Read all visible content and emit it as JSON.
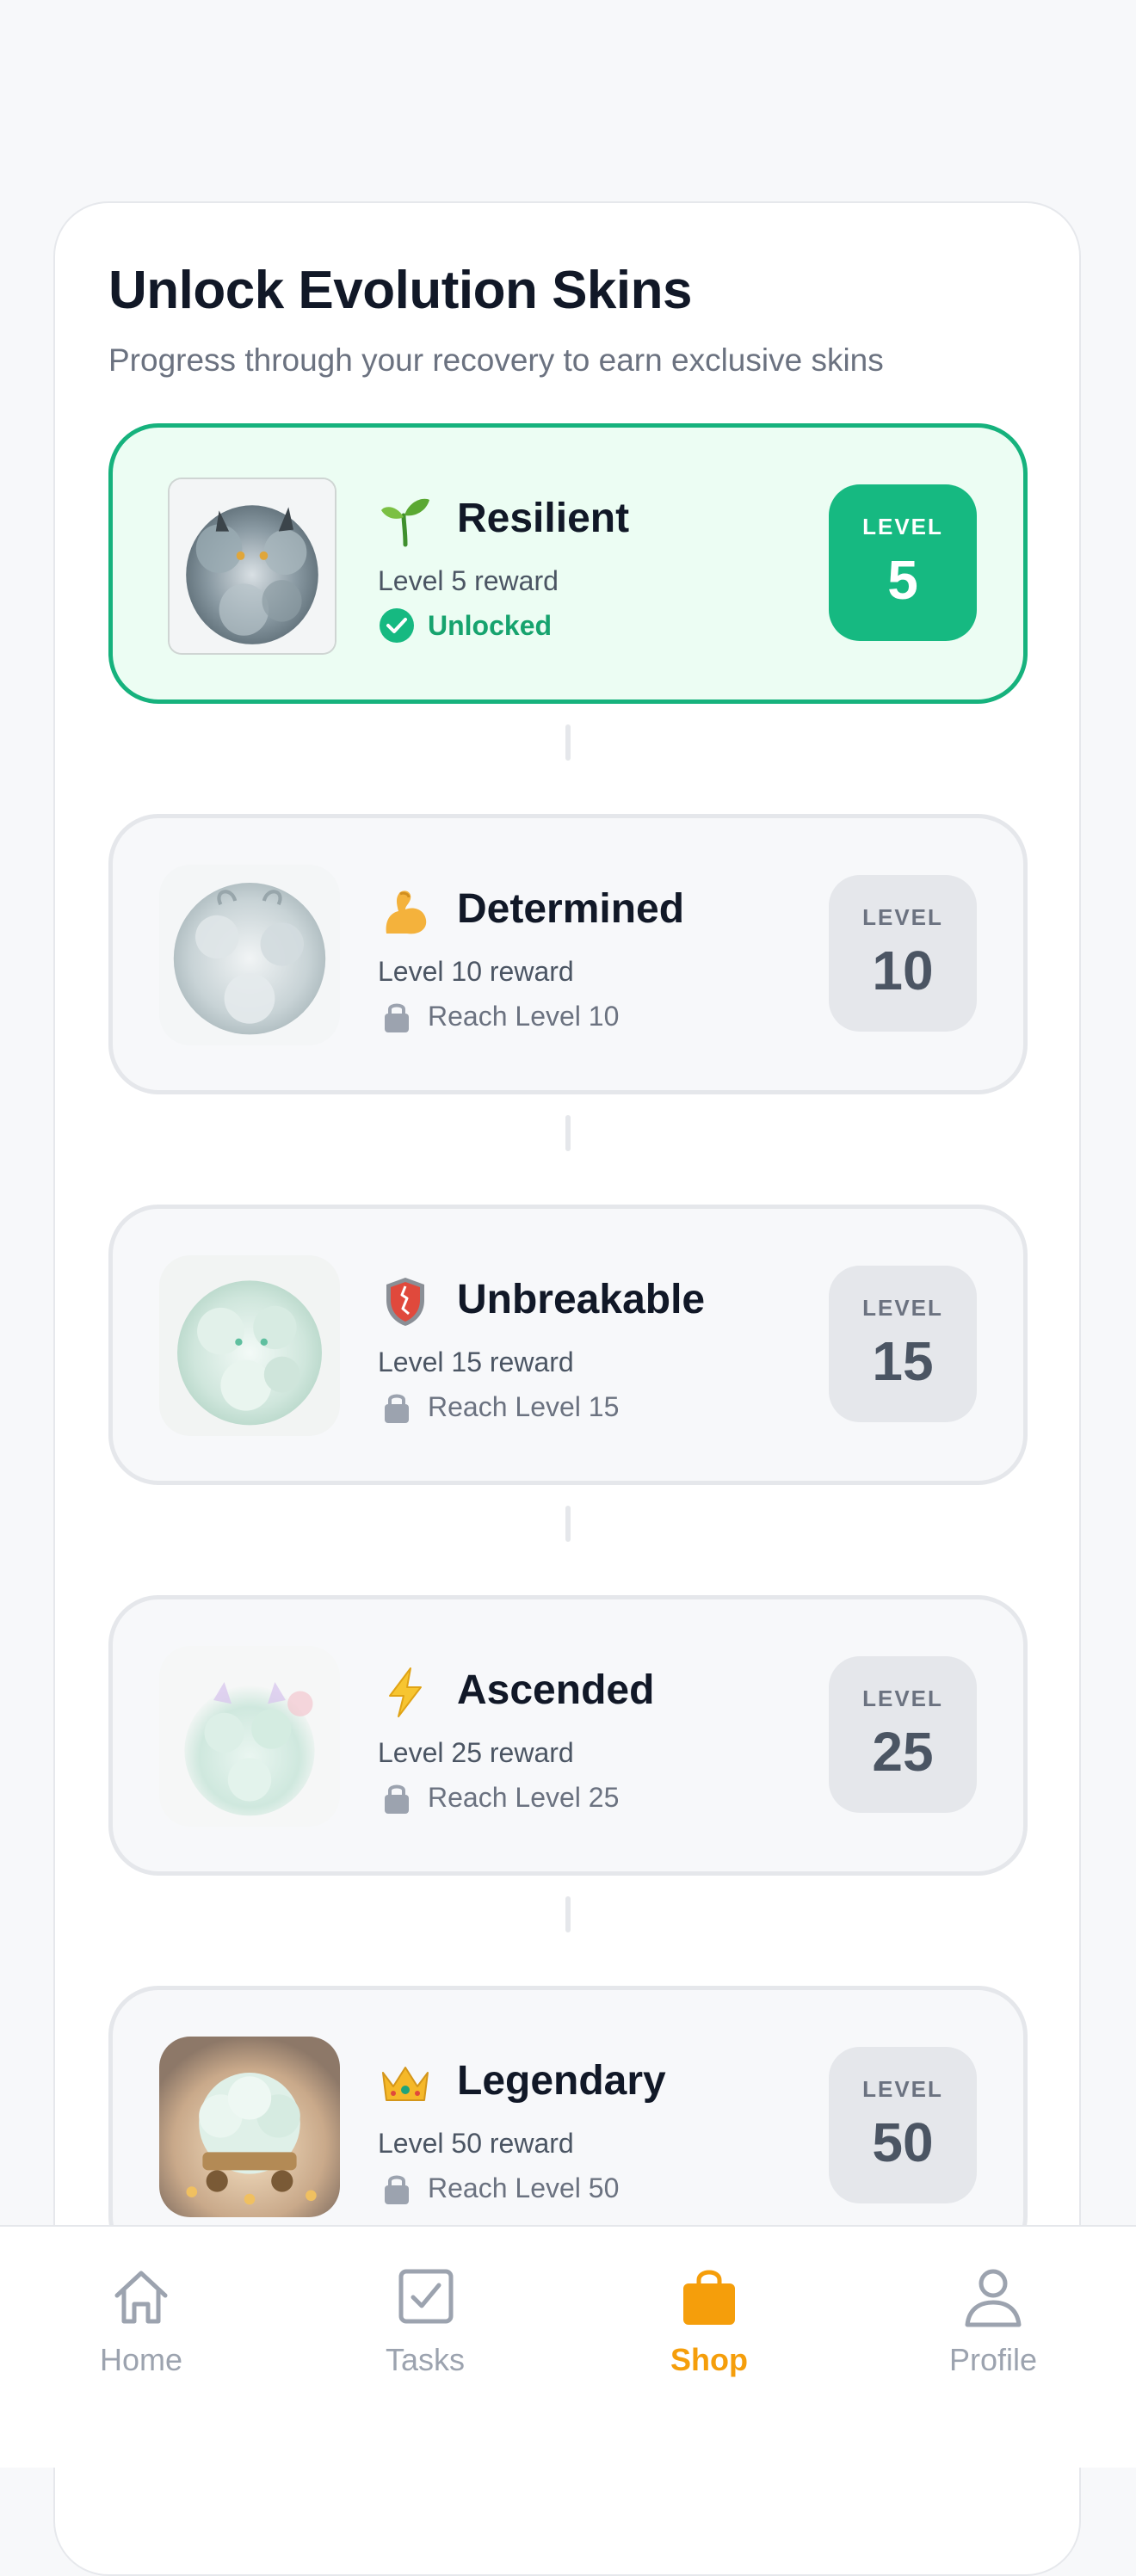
{
  "header": {
    "title": "Unlock Evolution Skins",
    "subtitle": "Progress through your recovery to earn exclusive skins"
  },
  "skins": [
    {
      "name": "Resilient",
      "emoji": "seedling-icon",
      "reward": "Level 5 reward",
      "status": "Unlocked",
      "unlocked": true,
      "badge_label": "LEVEL",
      "badge_level": "5"
    },
    {
      "name": "Determined",
      "emoji": "flexed-biceps-icon",
      "reward": "Level 10 reward",
      "status": "Reach Level 10",
      "unlocked": false,
      "badge_label": "LEVEL",
      "badge_level": "10"
    },
    {
      "name": "Unbreakable",
      "emoji": "shield-icon",
      "reward": "Level 15 reward",
      "status": "Reach Level 15",
      "unlocked": false,
      "badge_label": "LEVEL",
      "badge_level": "15"
    },
    {
      "name": "Ascended",
      "emoji": "lightning-icon",
      "reward": "Level 25 reward",
      "status": "Reach Level 25",
      "unlocked": false,
      "badge_label": "LEVEL",
      "badge_level": "25"
    },
    {
      "name": "Legendary",
      "emoji": "crown-icon",
      "reward": "Level 50 reward",
      "status": "Reach Level 50",
      "unlocked": false,
      "badge_label": "LEVEL",
      "badge_level": "50"
    }
  ],
  "nav": {
    "items": [
      {
        "label": "Home",
        "icon": "home-icon",
        "active": false
      },
      {
        "label": "Tasks",
        "icon": "tasks-icon",
        "active": false
      },
      {
        "label": "Shop",
        "icon": "shop-bag-icon",
        "active": true
      },
      {
        "label": "Profile",
        "icon": "profile-icon",
        "active": false
      }
    ]
  },
  "colors": {
    "accent_green": "#16b981",
    "unlocked_bg": "#ecfdf3",
    "active_nav": "#f59e0b",
    "locked_badge": "#e5e7eb"
  }
}
